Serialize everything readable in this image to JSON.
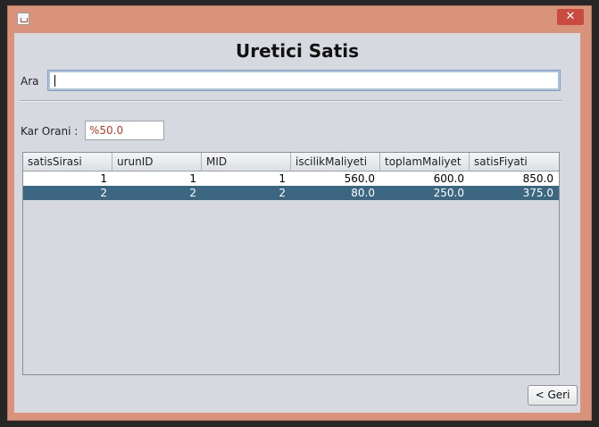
{
  "window": {
    "close_glyph": "✕",
    "app_icon": "java-cup-icon"
  },
  "form": {
    "title": "Uretici Satis",
    "search_label": "Ara",
    "search_value": "",
    "kar_label": "Kar Orani :",
    "kar_value": "%50.0"
  },
  "table": {
    "columns": [
      "satisSirasi",
      "urunID",
      "MID",
      "iscilikMaliyeti",
      "toplamMaliyet",
      "satisFiyati"
    ],
    "rows": [
      [
        "1",
        "1",
        "1",
        "560.0",
        "600.0",
        "850.0"
      ],
      [
        "2",
        "2",
        "2",
        "80.0",
        "250.0",
        "375.0"
      ]
    ],
    "selected_row": 2
  },
  "buttons": {
    "back_label": "< Geri"
  },
  "colors": {
    "frame": "#d8937a",
    "close": "#c94b3f",
    "selection": "#3b6783",
    "kar_text": "#c0392b"
  }
}
